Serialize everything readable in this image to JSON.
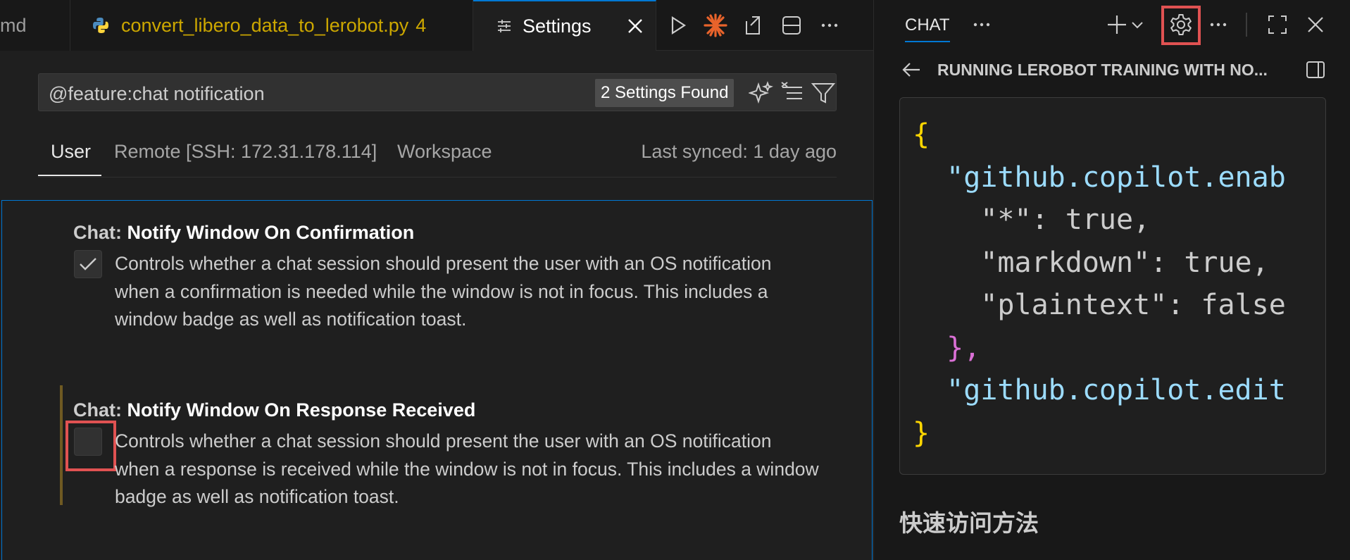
{
  "tabs": {
    "md_tab": "md",
    "py_tab": "convert_libero_data_to_lerobot.py",
    "py_badge": "4",
    "settings_tab": "Settings"
  },
  "search": {
    "query": "@feature:chat notification",
    "found": "2 Settings Found"
  },
  "scopes": {
    "user": "User",
    "remote": "Remote [SSH: 172.31.178.114]",
    "workspace": "Workspace",
    "synced": "Last synced: 1 day ago"
  },
  "settings": [
    {
      "category": "Chat: ",
      "title": "Notify Window On Confirmation",
      "checked": true,
      "description": "Controls whether a chat session should present the user with an OS notification when a confirmation is needed while the window is not in focus. This includes a window badge as well as notification toast."
    },
    {
      "category": "Chat: ",
      "title": "Notify Window On Response Received",
      "checked": false,
      "description": "Controls whether a chat session should present the user with an OS notification when a response is received while the window is not in focus. This includes a window badge as well as notification toast."
    }
  ],
  "chat": {
    "title": "CHAT",
    "conversation_title": "RUNNING LEROBOT TRAINING WITH NO...",
    "code_lines": [
      "{",
      "  \"github.copilot.enab",
      "    \"*\": true,",
      "    \"markdown\": true,",
      "    \"plaintext\": false",
      "  },",
      "  \"github.copilot.edit",
      "}"
    ],
    "section_heading": "快速访问方法"
  },
  "colors": {
    "accent": "#0078d4",
    "highlight": "#e05252",
    "modified_tab": "#cca700",
    "background": "#1f1f1f"
  },
  "icons": [
    "python-icon",
    "settings-sliders-icon",
    "close-icon",
    "run-icon",
    "spark-icon",
    "open-changes-icon",
    "split-editor-icon",
    "more-icon",
    "plus-icon",
    "chevron-down-icon",
    "gear-icon",
    "maximize-icon",
    "back-arrow-icon",
    "sidebar-toggle-icon",
    "sparkle-filter-icon",
    "clear-filter-icon",
    "filter-icon",
    "checkmark-icon"
  ]
}
